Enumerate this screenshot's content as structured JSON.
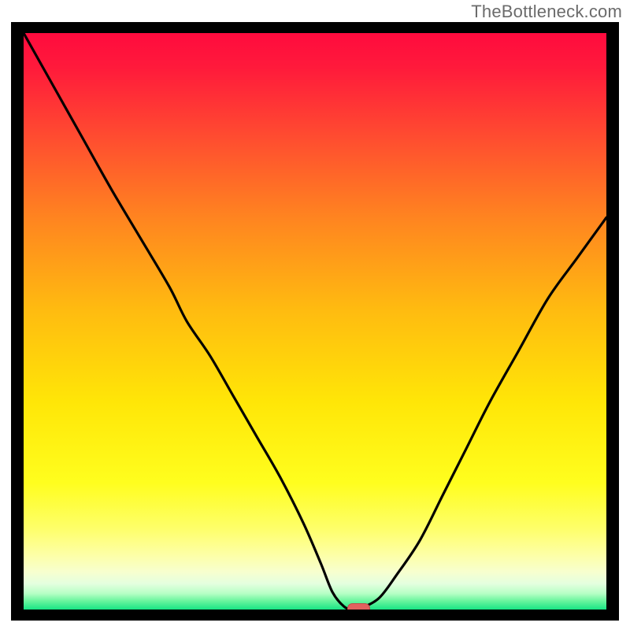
{
  "watermark": "TheBottleneck.com",
  "colors": {
    "border": "#000000",
    "curve": "#000000",
    "marker_fill": "#e2615f",
    "marker_stroke": "#c24b49",
    "gradient_stops": [
      {
        "offset": 0.0,
        "color": "#ff0b3e"
      },
      {
        "offset": 0.06,
        "color": "#ff1a3b"
      },
      {
        "offset": 0.18,
        "color": "#ff4c30"
      },
      {
        "offset": 0.32,
        "color": "#ff8420"
      },
      {
        "offset": 0.48,
        "color": "#ffbb10"
      },
      {
        "offset": 0.64,
        "color": "#ffe607"
      },
      {
        "offset": 0.78,
        "color": "#fffe1e"
      },
      {
        "offset": 0.86,
        "color": "#feff6a"
      },
      {
        "offset": 0.905,
        "color": "#fdffa6"
      },
      {
        "offset": 0.935,
        "color": "#f7ffcf"
      },
      {
        "offset": 0.955,
        "color": "#e4ffdf"
      },
      {
        "offset": 0.972,
        "color": "#b7ffc6"
      },
      {
        "offset": 0.985,
        "color": "#6af59e"
      },
      {
        "offset": 1.0,
        "color": "#18e584"
      }
    ]
  },
  "chart_data": {
    "type": "line",
    "title": "",
    "xlabel": "",
    "ylabel": "",
    "xlim": [
      0,
      100
    ],
    "ylim": [
      0,
      100
    ],
    "x": [
      0,
      5,
      10,
      15,
      20,
      25,
      28,
      32,
      36,
      40,
      44,
      48,
      51,
      53,
      55,
      56.5,
      58,
      61,
      64,
      68,
      72,
      76,
      80,
      85,
      90,
      95,
      100
    ],
    "values": [
      100,
      91,
      82,
      73,
      64.5,
      56,
      50,
      44,
      37,
      30,
      23,
      15,
      8,
      3,
      0.5,
      0,
      0.3,
      2,
      6,
      12,
      20,
      28,
      36,
      45,
      54,
      61,
      68
    ],
    "marker": {
      "x": 57.5,
      "y": 0
    },
    "annotations": []
  }
}
